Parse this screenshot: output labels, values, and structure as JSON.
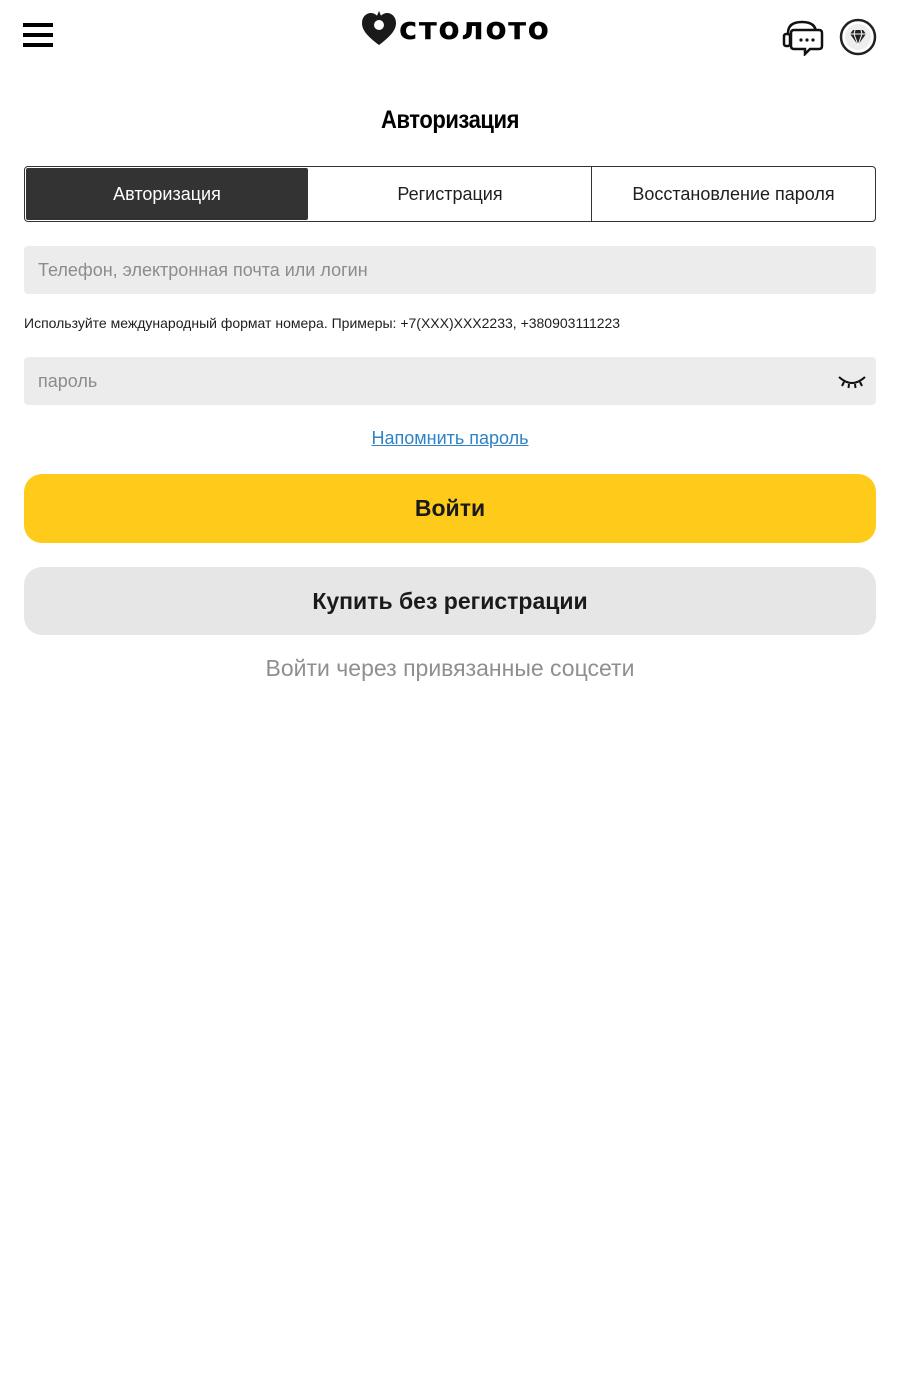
{
  "header": {
    "logo_text": "столото",
    "menu_icon": "hamburger-menu-icon",
    "chat_icon": "chat-support-icon",
    "bonus_icon": "diamond-bonus-icon"
  },
  "page": {
    "title": "Авторизация"
  },
  "tabs": [
    {
      "label": "Авторизация",
      "active": true
    },
    {
      "label": "Регистрация",
      "active": false
    },
    {
      "label": "Восстановление пароля",
      "active": false
    }
  ],
  "form": {
    "login_placeholder": "Телефон, электронная почта или логин",
    "login_value": "",
    "hint": "Используйте международный формат номера. Примеры: +7(XXX)XXX2233, +380903111223",
    "password_placeholder": "пароль",
    "password_value": "",
    "eye_icon": "password-hidden-eye-icon",
    "remind_link": "Напомнить пароль",
    "login_button": "Войти",
    "buy_button": "Купить без регистрации",
    "social_text": "Войти через привязанные соцсети"
  },
  "colors": {
    "accent": "#ffcb1a",
    "tab_active_bg": "#333333",
    "link": "#2f82c3",
    "input_bg": "#ececec",
    "secondary_button": "#e6e6e6",
    "muted_text": "#8f8f8f"
  }
}
